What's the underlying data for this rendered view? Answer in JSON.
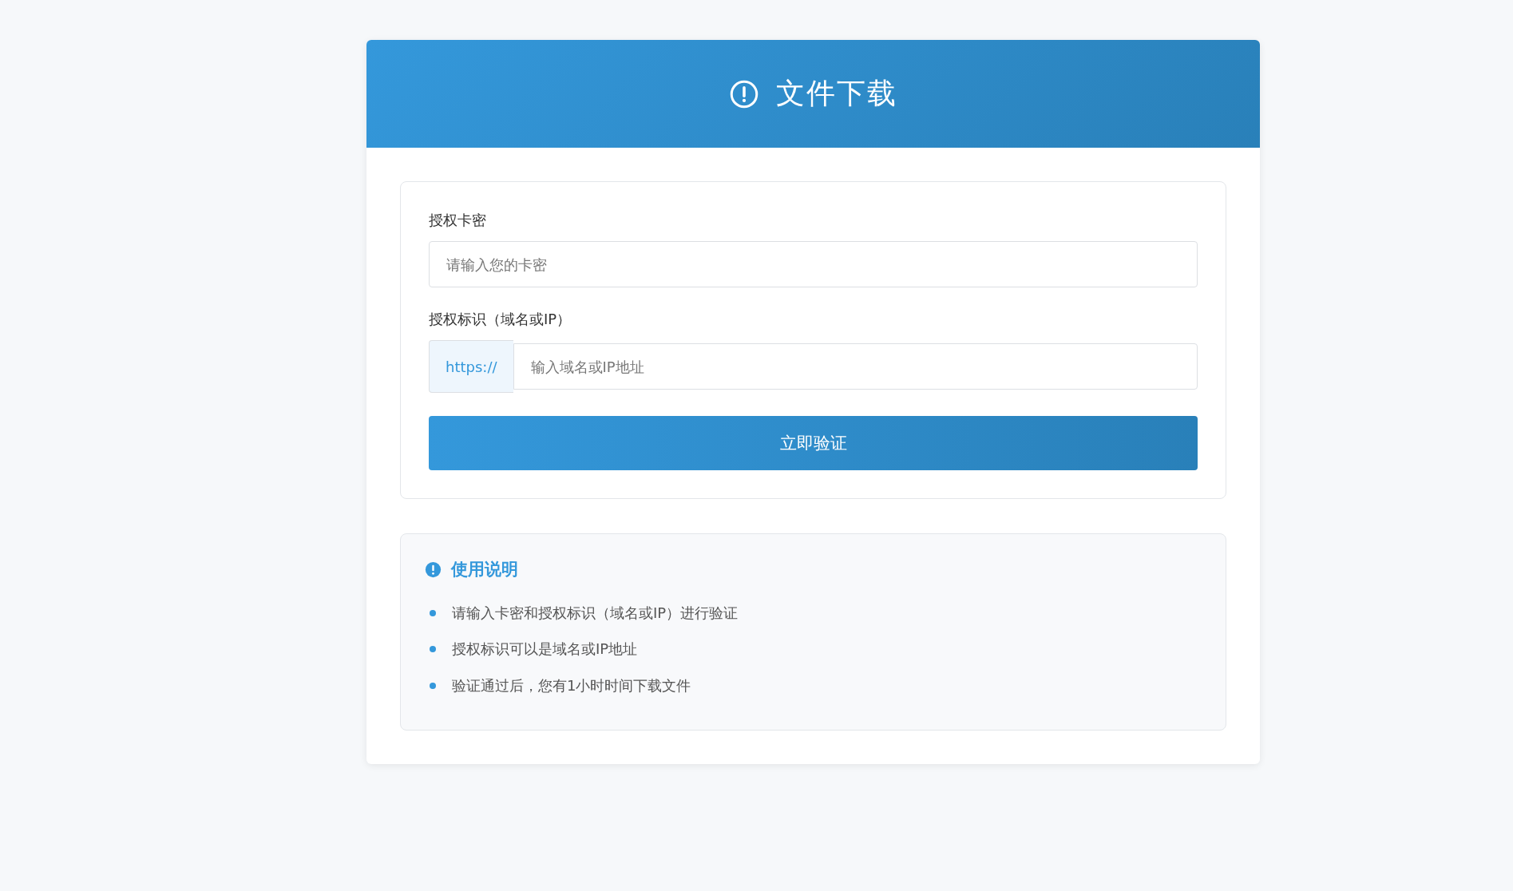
{
  "header": {
    "title": "文件下载"
  },
  "form": {
    "fields": [
      {
        "kind": "plain",
        "label": "授权卡密",
        "placeholder": "请输入您的卡密"
      },
      {
        "kind": "prefixed",
        "label": "授权标识（域名或IP）",
        "prefix": "https://",
        "placeholder": "输入域名或IP地址"
      }
    ],
    "submit": "立即验证"
  },
  "instructions": {
    "title": "使用说明",
    "items": [
      "请输入卡密和授权标识（域名或IP）进行验证",
      "授权标识可以是域名或IP地址",
      "验证通过后，您有1小时时间下载文件"
    ]
  }
}
